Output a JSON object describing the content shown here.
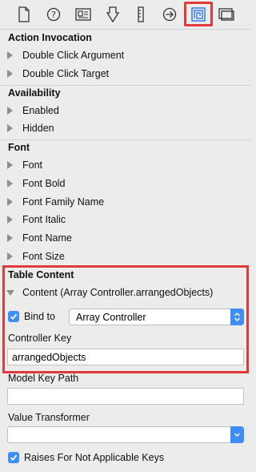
{
  "toolbar": {
    "icons": [
      "file-icon",
      "help-icon",
      "identity-icon",
      "attributes-icon",
      "size-icon",
      "connections-icon",
      "bindings-icon",
      "view-effects-icon"
    ],
    "selected": "bindings-icon",
    "highlight_color": "#e03a3a"
  },
  "sections": {
    "action_invocation": {
      "title": "Action Invocation",
      "items": [
        "Double Click Argument",
        "Double Click Target"
      ]
    },
    "availability": {
      "title": "Availability",
      "items": [
        "Enabled",
        "Hidden"
      ]
    },
    "font": {
      "title": "Font",
      "items": [
        "Font",
        "Font Bold",
        "Font Family Name",
        "Font Italic",
        "Font Name",
        "Font Size"
      ]
    },
    "table_content": {
      "title": "Table Content",
      "content_item": "Content (Array Controller.arrangedObjects)",
      "bind_to_label": "Bind to",
      "bind_to_checked": true,
      "bind_to_value": "Array Controller",
      "controller_key_label": "Controller Key",
      "controller_key_value": "arrangedObjects",
      "model_key_path_label": "Model Key Path",
      "model_key_path_value": "",
      "value_transformer_label": "Value Transformer",
      "value_transformer_value": "",
      "raises_label": "Raises For Not Applicable Keys",
      "raises_checked": true
    }
  },
  "colors": {
    "accent": "#3d8ef5",
    "background": "#ececec",
    "highlight": "#e03a3a"
  }
}
